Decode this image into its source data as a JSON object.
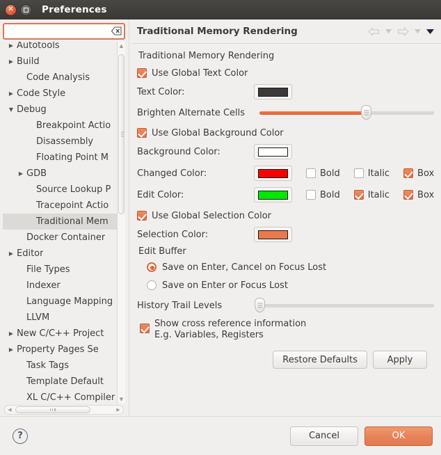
{
  "window": {
    "title": "Preferences",
    "close_icon": "close-icon",
    "maximize_icon": "maximize-icon"
  },
  "sidebar": {
    "search": {
      "value": "",
      "placeholder": "",
      "clear_icon": "clear-icon"
    },
    "items": [
      {
        "label": "Autotools",
        "indent": 0,
        "twisty": "collapsed",
        "selected": false,
        "clipped": true
      },
      {
        "label": "Build",
        "indent": 0,
        "twisty": "collapsed",
        "selected": false
      },
      {
        "label": "Code Analysis",
        "indent": 1,
        "twisty": "none",
        "selected": false
      },
      {
        "label": "Code Style",
        "indent": 0,
        "twisty": "collapsed",
        "selected": false
      },
      {
        "label": "Debug",
        "indent": 0,
        "twisty": "expanded",
        "selected": false
      },
      {
        "label": "Breakpoint Actio",
        "indent": 2,
        "twisty": "none",
        "selected": false
      },
      {
        "label": "Disassembly",
        "indent": 2,
        "twisty": "none",
        "selected": false
      },
      {
        "label": "Floating Point M",
        "indent": 2,
        "twisty": "none",
        "selected": false
      },
      {
        "label": "GDB",
        "indent": 1,
        "twisty": "collapsed",
        "selected": false
      },
      {
        "label": "Source Lookup P",
        "indent": 2,
        "twisty": "none",
        "selected": false
      },
      {
        "label": "Tracepoint Actio",
        "indent": 2,
        "twisty": "none",
        "selected": false
      },
      {
        "label": "Traditional Mem",
        "indent": 2,
        "twisty": "none",
        "selected": true
      },
      {
        "label": "Docker Container",
        "indent": 1,
        "twisty": "none",
        "selected": false
      },
      {
        "label": "Editor",
        "indent": 0,
        "twisty": "collapsed",
        "selected": false
      },
      {
        "label": "File Types",
        "indent": 1,
        "twisty": "none",
        "selected": false
      },
      {
        "label": "Indexer",
        "indent": 1,
        "twisty": "none",
        "selected": false
      },
      {
        "label": "Language Mapping",
        "indent": 1,
        "twisty": "none",
        "selected": false
      },
      {
        "label": "LLVM",
        "indent": 1,
        "twisty": "none",
        "selected": false
      },
      {
        "label": "New C/C++ Project",
        "indent": 0,
        "twisty": "collapsed",
        "selected": false
      },
      {
        "label": "Property Pages Se",
        "indent": 0,
        "twisty": "collapsed",
        "selected": false
      },
      {
        "label": "Task Tags",
        "indent": 1,
        "twisty": "none",
        "selected": false
      },
      {
        "label": "Template Default",
        "indent": 1,
        "twisty": "none",
        "selected": false
      },
      {
        "label": "XL C/C++ Compiler",
        "indent": 1,
        "twisty": "none",
        "selected": false
      }
    ]
  },
  "page": {
    "title": "Traditional Memory Rendering",
    "nav": {
      "back_icon": "back-arrow-icon",
      "back_menu_icon": "chevron-down-icon",
      "forward_icon": "forward-arrow-icon",
      "forward_menu_icon": "chevron-down-icon",
      "menu_icon": "chevron-down-filled-icon"
    },
    "group_label": "Traditional Memory Rendering",
    "use_global_text_color": {
      "label": "Use Global Text Color",
      "checked": true
    },
    "text_color": {
      "label": "Text Color:",
      "value": "#3a3a3a"
    },
    "brighten_alternate_cells": {
      "label": "Brighten Alternate Cells",
      "percent": 61
    },
    "use_global_background_color": {
      "label": "Use Global Background Color",
      "checked": true
    },
    "background_color": {
      "label": "Background Color:",
      "value": "#ffffff"
    },
    "changed_color": {
      "label": "Changed Color:",
      "value": "#fa0000",
      "bold": {
        "label": "Bold",
        "checked": false
      },
      "italic": {
        "label": "Italic",
        "checked": false
      },
      "box": {
        "label": "Box",
        "checked": true
      }
    },
    "edit_color": {
      "label": "Edit Color:",
      "value": "#00e800",
      "bold": {
        "label": "Bold",
        "checked": false
      },
      "italic": {
        "label": "Italic",
        "checked": true
      },
      "box": {
        "label": "Box",
        "checked": true
      }
    },
    "use_global_selection_color": {
      "label": "Use Global Selection Color",
      "checked": true
    },
    "selection_color": {
      "label": "Selection Color:",
      "value": "#e8784d"
    },
    "edit_buffer": {
      "label": "Edit Buffer",
      "options": [
        {
          "label": "Save on Enter, Cancel on Focus Lost",
          "selected": true
        },
        {
          "label": "Save on Enter or Focus Lost",
          "selected": false
        }
      ]
    },
    "history_trail_levels": {
      "label": "History Trail Levels",
      "percent": 0
    },
    "show_cross_reference": {
      "line1": "Show cross reference information",
      "line2": "E.g. Variables, Registers",
      "checked": true
    },
    "restore_defaults_label": "Restore Defaults",
    "apply_label": "Apply"
  },
  "footer": {
    "help_label": "?",
    "cancel_label": "Cancel",
    "ok_label": "OK"
  },
  "colors": {
    "accent": "#e2754a",
    "titlebar": "#3b3936",
    "window_bg": "#f0efee",
    "selection_row": "#dcdad6"
  }
}
